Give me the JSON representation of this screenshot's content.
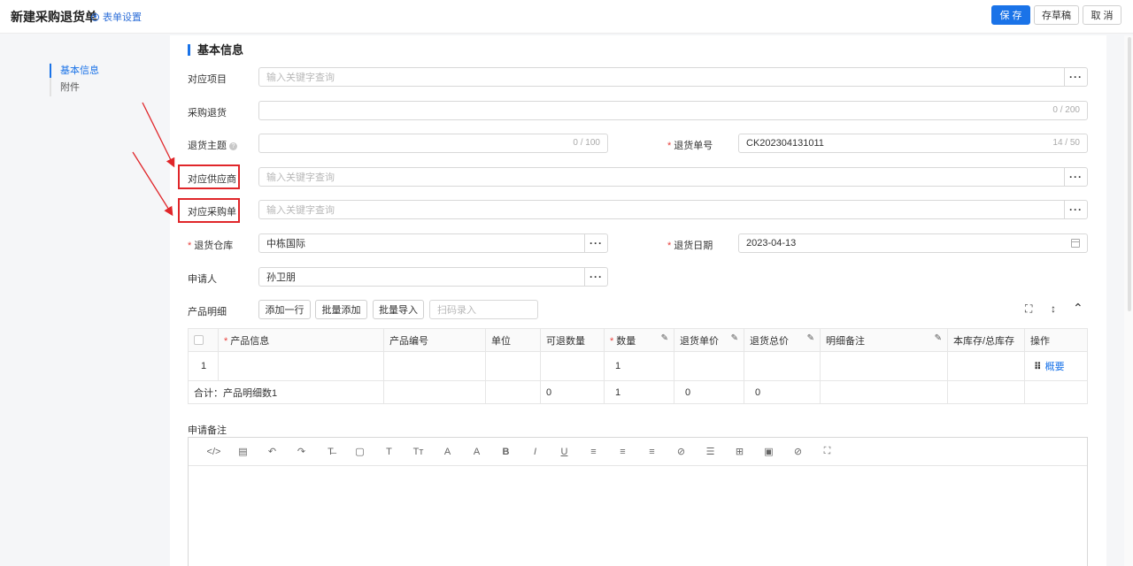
{
  "header": {
    "title": "新建采购退货单",
    "form_settings": "表单设置",
    "save": "保 存",
    "draft": "存草稿",
    "cancel": "取 消"
  },
  "sidebar": {
    "items": [
      {
        "label": "基本信息",
        "active": true
      },
      {
        "label": "附件",
        "active": false
      }
    ]
  },
  "section": {
    "title": "基本信息"
  },
  "form": {
    "project": {
      "label": "对应项目",
      "placeholder": "输入关键字查询"
    },
    "purchase_return": {
      "label": "采购退货",
      "count": "0 / 200"
    },
    "subject": {
      "label": "退货主题",
      "count": "0 / 100"
    },
    "return_no": {
      "label": "退货单号",
      "value": "CK202304131011",
      "count": "14 / 50"
    },
    "supplier": {
      "label": "对应供应商",
      "placeholder": "输入关键字查询"
    },
    "purchase_order": {
      "label": "对应采购单",
      "placeholder": "输入关键字查询"
    },
    "warehouse": {
      "label": "退货仓库",
      "value": "中栋国际"
    },
    "return_date": {
      "label": "退货日期",
      "value": "2023-04-13"
    },
    "applicant": {
      "label": "申请人",
      "value": "孙卫朋"
    }
  },
  "products": {
    "label": "产品明细",
    "add_row": "添加一行",
    "batch_add": "批量添加",
    "batch_import": "批量导入",
    "scan_placeholder": "扫码录入",
    "columns": [
      "产品信息",
      "产品编号",
      "单位",
      "可退数量",
      "数量",
      "退货单价",
      "退货总价",
      "明细备注",
      "本库存/总库存",
      "操作"
    ],
    "row": {
      "index": "1",
      "quantity": "1",
      "action": "概要"
    },
    "summary": {
      "label": "合计：产品明细数1",
      "returnable": "0",
      "quantity": "1",
      "unit_price": "0",
      "total": "0"
    }
  },
  "remarks": {
    "label": "申请备注"
  },
  "toolbar_icons": [
    "</>",
    "▤",
    "↶",
    "↷",
    "T̶",
    "▢",
    "T",
    "Tт",
    "A",
    "A",
    "B",
    "I",
    "U",
    "≡",
    "≡",
    "≡",
    "⊘",
    "☰",
    "⊞",
    "▣",
    "⊘",
    "⛶"
  ],
  "colors": {
    "primary": "#1a73e8",
    "highlight": "#e0262a",
    "required": "#e8413d"
  }
}
